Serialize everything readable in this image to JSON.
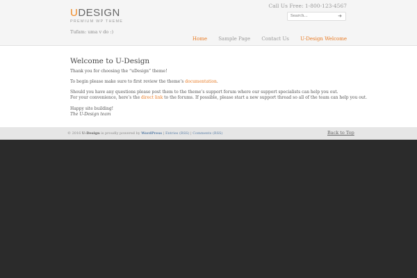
{
  "header": {
    "logo_u": "U",
    "logo_rest": "DESIGN",
    "logo_sub": "PREMIUM WP THEME",
    "tagline": "Tufam: uma v do :)",
    "phone": "Call Us Free: 1-800-123-4567",
    "search_placeholder": "Search...",
    "nav": [
      "Home",
      "Sample Page",
      "Contact Us",
      "U-Design Welcome"
    ]
  },
  "main": {
    "title": "Welcome to U-Design",
    "p1": "Thank you for choosing the “uDesign” theme!",
    "p2_pre": "To begin please make sure to first review the theme’s ",
    "p2_link": "documentation",
    "p2_post": ".",
    "p3": "Should you have any questions please post them to the theme’s support forum where our support specialists can help you out.",
    "p4_pre": "For your convenience, here’s the ",
    "p4_link": "direct link",
    "p4_post": " to the forums. If possible, please start a new support thread so all of the team can help you out.",
    "p5": "Happy site building!",
    "p6": "The U-Design team"
  },
  "footer": {
    "copyright_pre": "© 2016 ",
    "site": "U-Design",
    "powered": " is proudly powered by ",
    "wp": "WordPress",
    "sep1": " | ",
    "entries": "Entries (RSS)",
    "sep2": " | ",
    "comments": "Comments (RSS)",
    "back_top": "Back to Top"
  }
}
